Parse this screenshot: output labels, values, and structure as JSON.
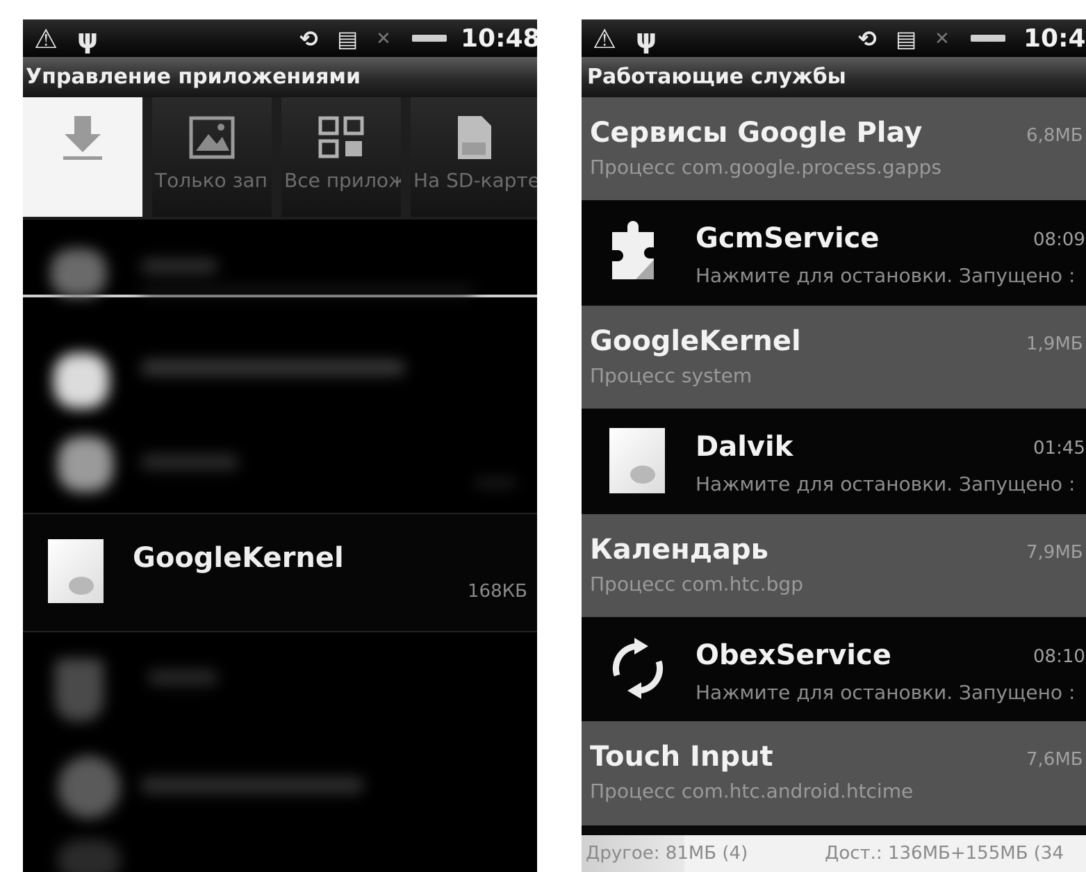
{
  "status": {
    "time": "10:48"
  },
  "left": {
    "title": "Управление приложениями",
    "tabs": [
      {
        "label": "",
        "icon": "download-icon",
        "active": true
      },
      {
        "label": "Только зап",
        "icon": "image-icon",
        "active": false
      },
      {
        "label": "Все прилож",
        "icon": "grid-icon",
        "active": false
      },
      {
        "label": "На SD-карте",
        "icon": "sd-card-icon",
        "active": false
      }
    ],
    "highlighted_app": {
      "name": "GoogleKernel",
      "size": "168КБ"
    }
  },
  "right": {
    "title": "Работающие службы",
    "items": [
      {
        "type": "process",
        "title": "Сервисы Google Play",
        "subtitle": "Процесс com.google.process.gapps",
        "mem": "6,8МБ"
      },
      {
        "type": "service",
        "title": "GcmService",
        "subtitle": "Нажмите для остановки. Запущено :",
        "mem": "08:09",
        "icon": "puzzle-icon"
      },
      {
        "type": "process",
        "title": "GoogleKernel",
        "subtitle": "Процесс system",
        "mem": "1,9МБ"
      },
      {
        "type": "service",
        "title": "Dalvik",
        "subtitle": "Нажмите для остановки. Запущено :",
        "mem": "01:45",
        "icon": "app-default-icon"
      },
      {
        "type": "process",
        "title": "Календарь",
        "subtitle": "Процесс com.htc.bgp",
        "mem": "7,9МБ"
      },
      {
        "type": "service",
        "title": "ObexService",
        "subtitle": "Нажмите для остановки. Запущено :",
        "mem": "08:10",
        "icon": "sync-icon"
      },
      {
        "type": "process",
        "title": "Touch Input",
        "subtitle": "Процесс com.htc.android.htcime",
        "mem": "7,6МБ"
      }
    ],
    "footer": {
      "other": "Другое: 81МБ (4)",
      "available": "Дост.: 136МБ+155МБ (34"
    }
  }
}
